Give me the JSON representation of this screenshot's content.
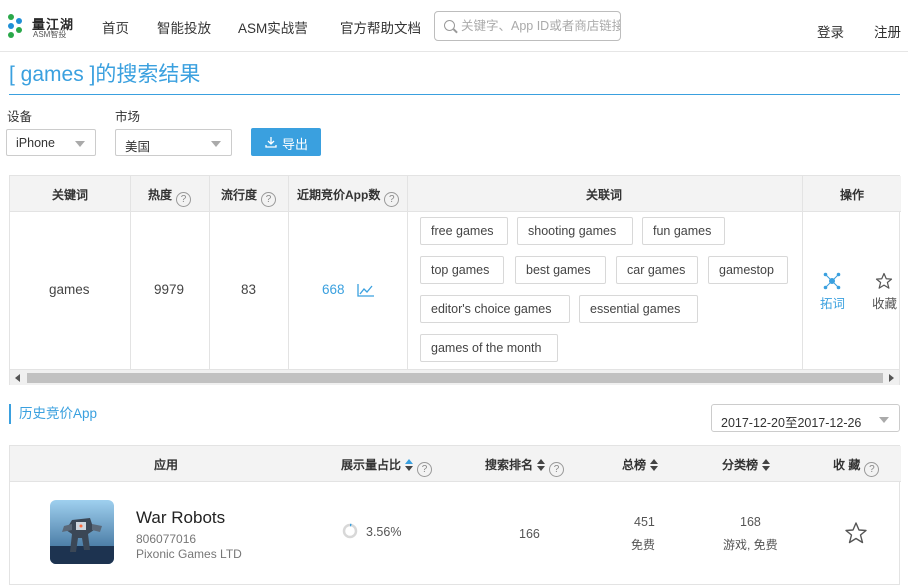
{
  "brand": {
    "name": "量江湖",
    "sub": "ASM智投"
  },
  "nav": {
    "items": [
      "首页",
      "智能投放",
      "ASM实战营",
      "官方帮助文档"
    ]
  },
  "search": {
    "placeholder": "关键字、App ID或者商店链接"
  },
  "auth": {
    "login": "登录",
    "register": "注册"
  },
  "page": {
    "title": "[ games ]的搜索结果"
  },
  "filters": {
    "device_label": "设备",
    "device_value": "iPhone",
    "market_label": "市场",
    "market_value": "美国",
    "export_label": "导出"
  },
  "keyword_table": {
    "headers": [
      "关键词",
      "热度",
      "流行度",
      "近期竞价App数",
      "关联词",
      "操作"
    ],
    "row": {
      "keyword": "games",
      "heat": "9979",
      "popularity": "83",
      "bid_apps": "668"
    },
    "related": [
      "free games",
      "shooting games",
      "fun games",
      "top games",
      "best games",
      "car games",
      "gamestop",
      "editor's choice games",
      "essential games",
      "games of the month"
    ],
    "actions": {
      "expand": "拓词",
      "favorite": "收藏"
    }
  },
  "history": {
    "title": "历史竞价App",
    "date_range": "2017-12-20至2017-12-26",
    "headers": [
      "应用",
      "展示量占比",
      "搜索排名",
      "总榜",
      "分类榜",
      "收 藏"
    ],
    "row": {
      "app_name": "War Robots",
      "app_id": "806077016",
      "developer": "Pixonic Games LTD",
      "share": "3.56%",
      "share_value": 3.56,
      "rank": "166",
      "total_rank": "451",
      "total_type": "免费",
      "category_rank": "168",
      "category_type": "游戏, 免费"
    }
  },
  "colors": {
    "accent": "#3aa0df",
    "header_bg": "#f3f3f3",
    "border": "#e3e3e3"
  }
}
